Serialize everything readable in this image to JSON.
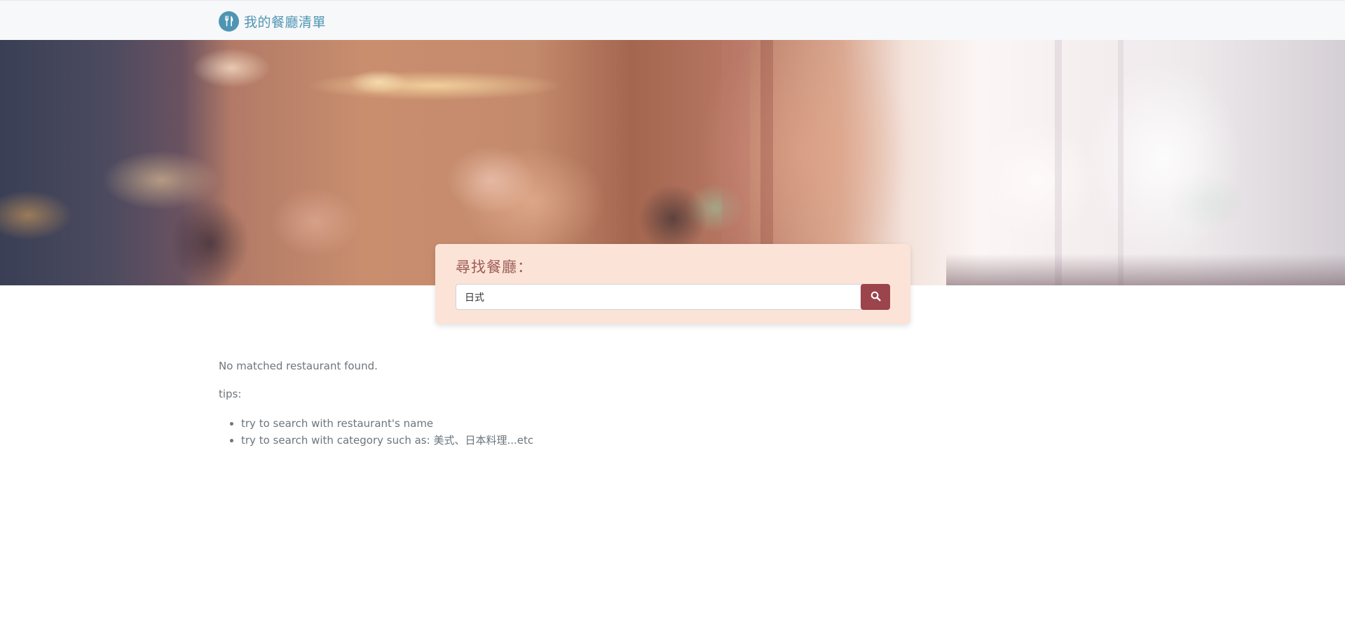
{
  "navbar": {
    "brand_text": "我的餐廳清單",
    "brand_icon": "utensils-icon",
    "brand_color": "#4f95b3"
  },
  "search": {
    "title": "尋找餐廳：",
    "input_value": "日式",
    "button_icon": "search-icon",
    "card_color": "#fce3d7",
    "button_color": "#9b444c"
  },
  "results": {
    "message": "No matched restaurant found.",
    "tips_label": "tips:",
    "tips": [
      "try to search with restaurant's name",
      "try to search with category such as: 美式、日本料理...etc"
    ],
    "text_color": "#6c757d"
  }
}
